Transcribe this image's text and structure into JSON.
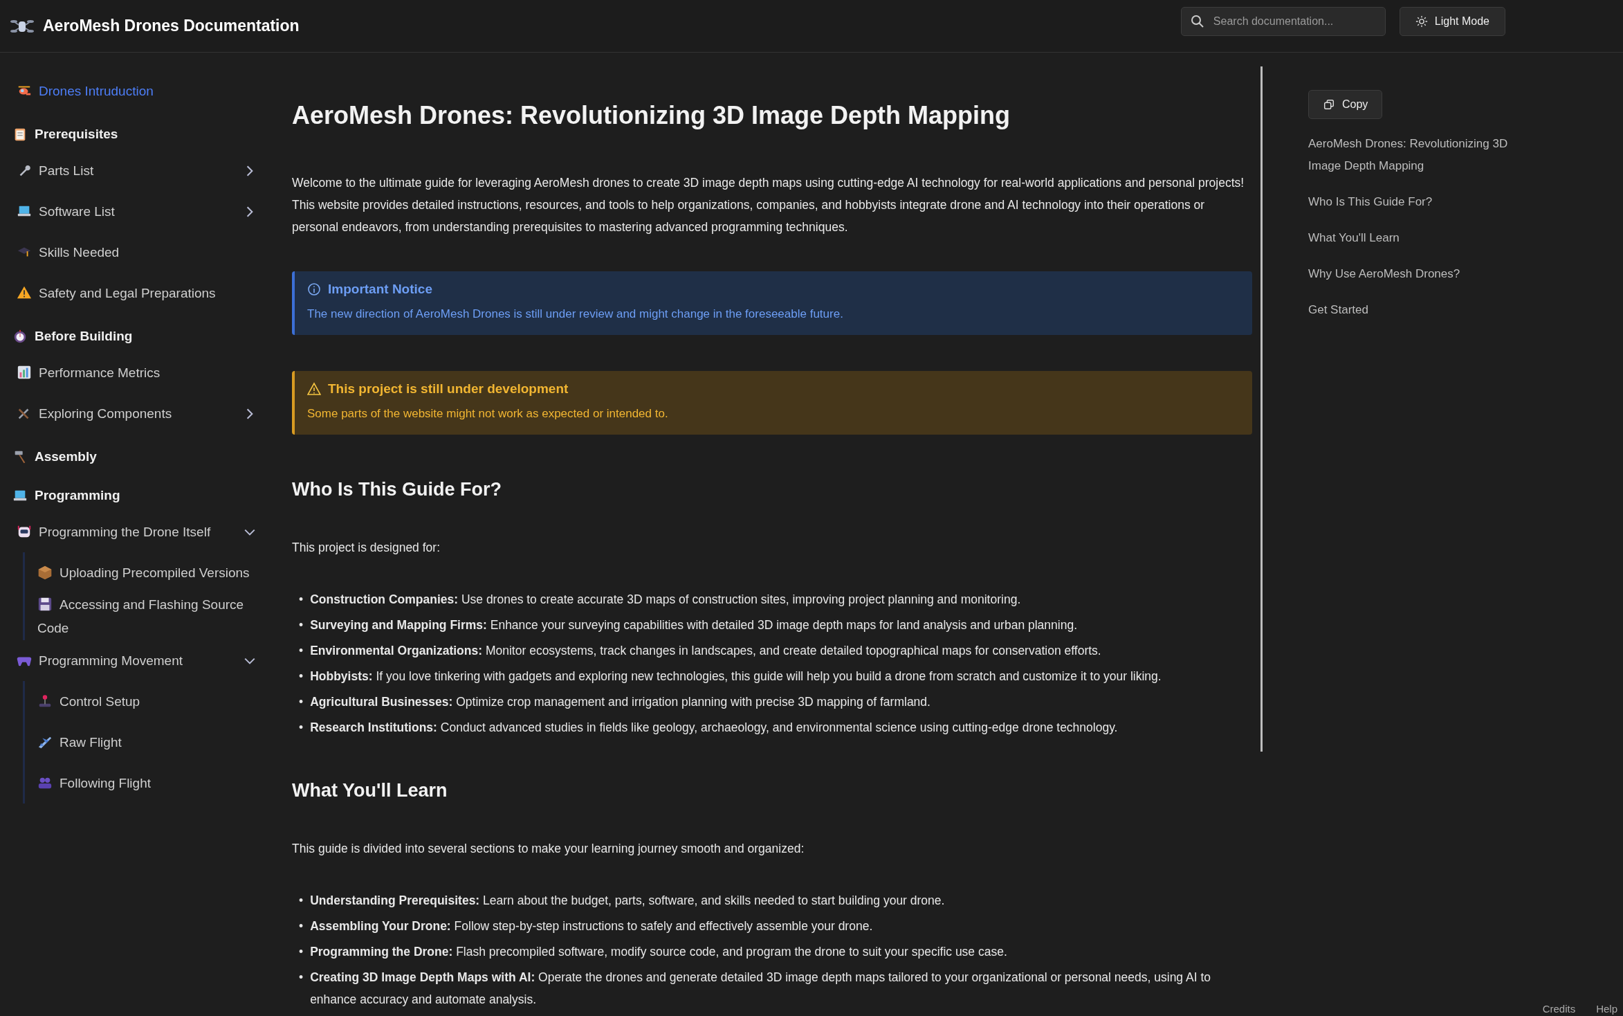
{
  "header": {
    "title": "AeroMesh Drones Documentation",
    "search": {
      "placeholder": "Search documentation..."
    },
    "theme_button": "Light Mode"
  },
  "sidebar": {
    "items": [
      {
        "label": "Drones Intruduction",
        "kind": "link",
        "selected": true
      },
      {
        "label": "Prerequisites",
        "kind": "section",
        "selected": false,
        "children": [
          {
            "label": "Parts List",
            "kind": "group",
            "selected": false,
            "expanded": false
          },
          {
            "label": "Software List",
            "kind": "group",
            "selected": false,
            "expanded": false
          },
          {
            "label": "Skills Needed",
            "kind": "link",
            "selected": false
          },
          {
            "label": "Safety and Legal Preparations",
            "kind": "link",
            "selected": false
          }
        ]
      },
      {
        "label": "Before Building",
        "kind": "section",
        "selected": false,
        "children": [
          {
            "label": "Performance Metrics",
            "kind": "link",
            "selected": false
          },
          {
            "label": "Exploring Components",
            "kind": "group",
            "selected": false,
            "expanded": false
          }
        ]
      },
      {
        "label": "Assembly",
        "kind": "section",
        "selected": false
      },
      {
        "label": "Programming",
        "kind": "section",
        "selected": false,
        "children": [
          {
            "label": "Programming the Drone Itself",
            "kind": "group",
            "selected": false,
            "expanded": true,
            "children": [
              {
                "label": "Uploading Precompiled Versions",
                "kind": "link",
                "selected": false
              },
              {
                "label": "Accessing and Flashing Source Code",
                "kind": "link",
                "selected": false
              }
            ]
          },
          {
            "label": "Programming Movement",
            "kind": "group",
            "selected": false,
            "expanded": true,
            "children": [
              {
                "label": "Control Setup",
                "kind": "link",
                "selected": false
              },
              {
                "label": "Raw Flight",
                "kind": "link",
                "selected": false
              },
              {
                "label": "Following Flight",
                "kind": "link",
                "selected": false
              }
            ]
          }
        ]
      }
    ]
  },
  "content": {
    "title": "AeroMesh Drones: Revolutionizing 3D Image Depth Mapping",
    "intro": "Welcome to the ultimate guide for leveraging AeroMesh drones to create 3D image depth maps using cutting-edge AI technology for real-world applications and personal projects! This website provides detailed instructions, resources, and tools to help organizations, companies, and hobbyists integrate drone and AI technology into their operations or personal endeavors, from understanding prerequisites to mastering advanced programming techniques.",
    "notices": [
      {
        "kind": "info",
        "title": "Important Notice",
        "text": "The new direction of AeroMesh Drones is still under review and might change in the foreseeable future."
      },
      {
        "kind": "warning",
        "title": "This project is still under development",
        "text": "Some parts of the website might not work as expected or intended to."
      }
    ],
    "sections": [
      {
        "heading": "Who Is This Guide For?",
        "lead": "This project is designed for:",
        "marker": "•",
        "bullets": [
          "**Construction Companies:** Use drones to create accurate 3D maps of construction sites, improving project planning and monitoring.",
          "**Surveying and Mapping Firms:** Enhance your surveying capabilities with detailed 3D image depth maps for land analysis and urban planning.",
          "**Environmental Organizations:** Monitor ecosystems, track changes in landscapes, and create detailed topographical maps for conservation efforts.",
          "**Hobbyists:** If you love tinkering with gadgets and exploring new technologies, this guide will help you build a drone from scratch and customize it to your liking.",
          "**Agricultural Businesses:** Optimize crop management and irrigation planning with precise 3D mapping of farmland.",
          "**Research Institutions:** Conduct advanced studies in fields like geology, archaeology, and environmental science using cutting-edge drone technology."
        ]
      },
      {
        "heading": "What You'll Learn",
        "lead": "This guide is divided into several sections to make your learning journey smooth and organized:",
        "marker": "•",
        "bullets": [
          "**Understanding Prerequisites:** Learn about the budget, parts, software, and skills needed to start building your drone.",
          "**Assembling Your Drone:** Follow step-by-step instructions to safely and effectively assemble your drone.",
          "**Programming the Drone:** Flash precompiled software, modify source code, and program the drone to suit your specific use case.",
          "**Creating 3D Image Depth Maps with AI:** Operate the drones and generate detailed 3D image depth maps tailored to your organizational or personal needs, using AI to enhance accuracy and automate analysis."
        ]
      }
    ]
  },
  "toc": {
    "copy_button": "Copy",
    "items": [
      "AeroMesh Drones: Revolutionizing 3D Image Depth Mapping",
      "Who Is This Guide For?",
      "What You'll Learn",
      "Why Use AeroMesh Drones?",
      "Get Started"
    ]
  },
  "footer": {
    "links": [
      "Credits",
      "Help"
    ]
  }
}
